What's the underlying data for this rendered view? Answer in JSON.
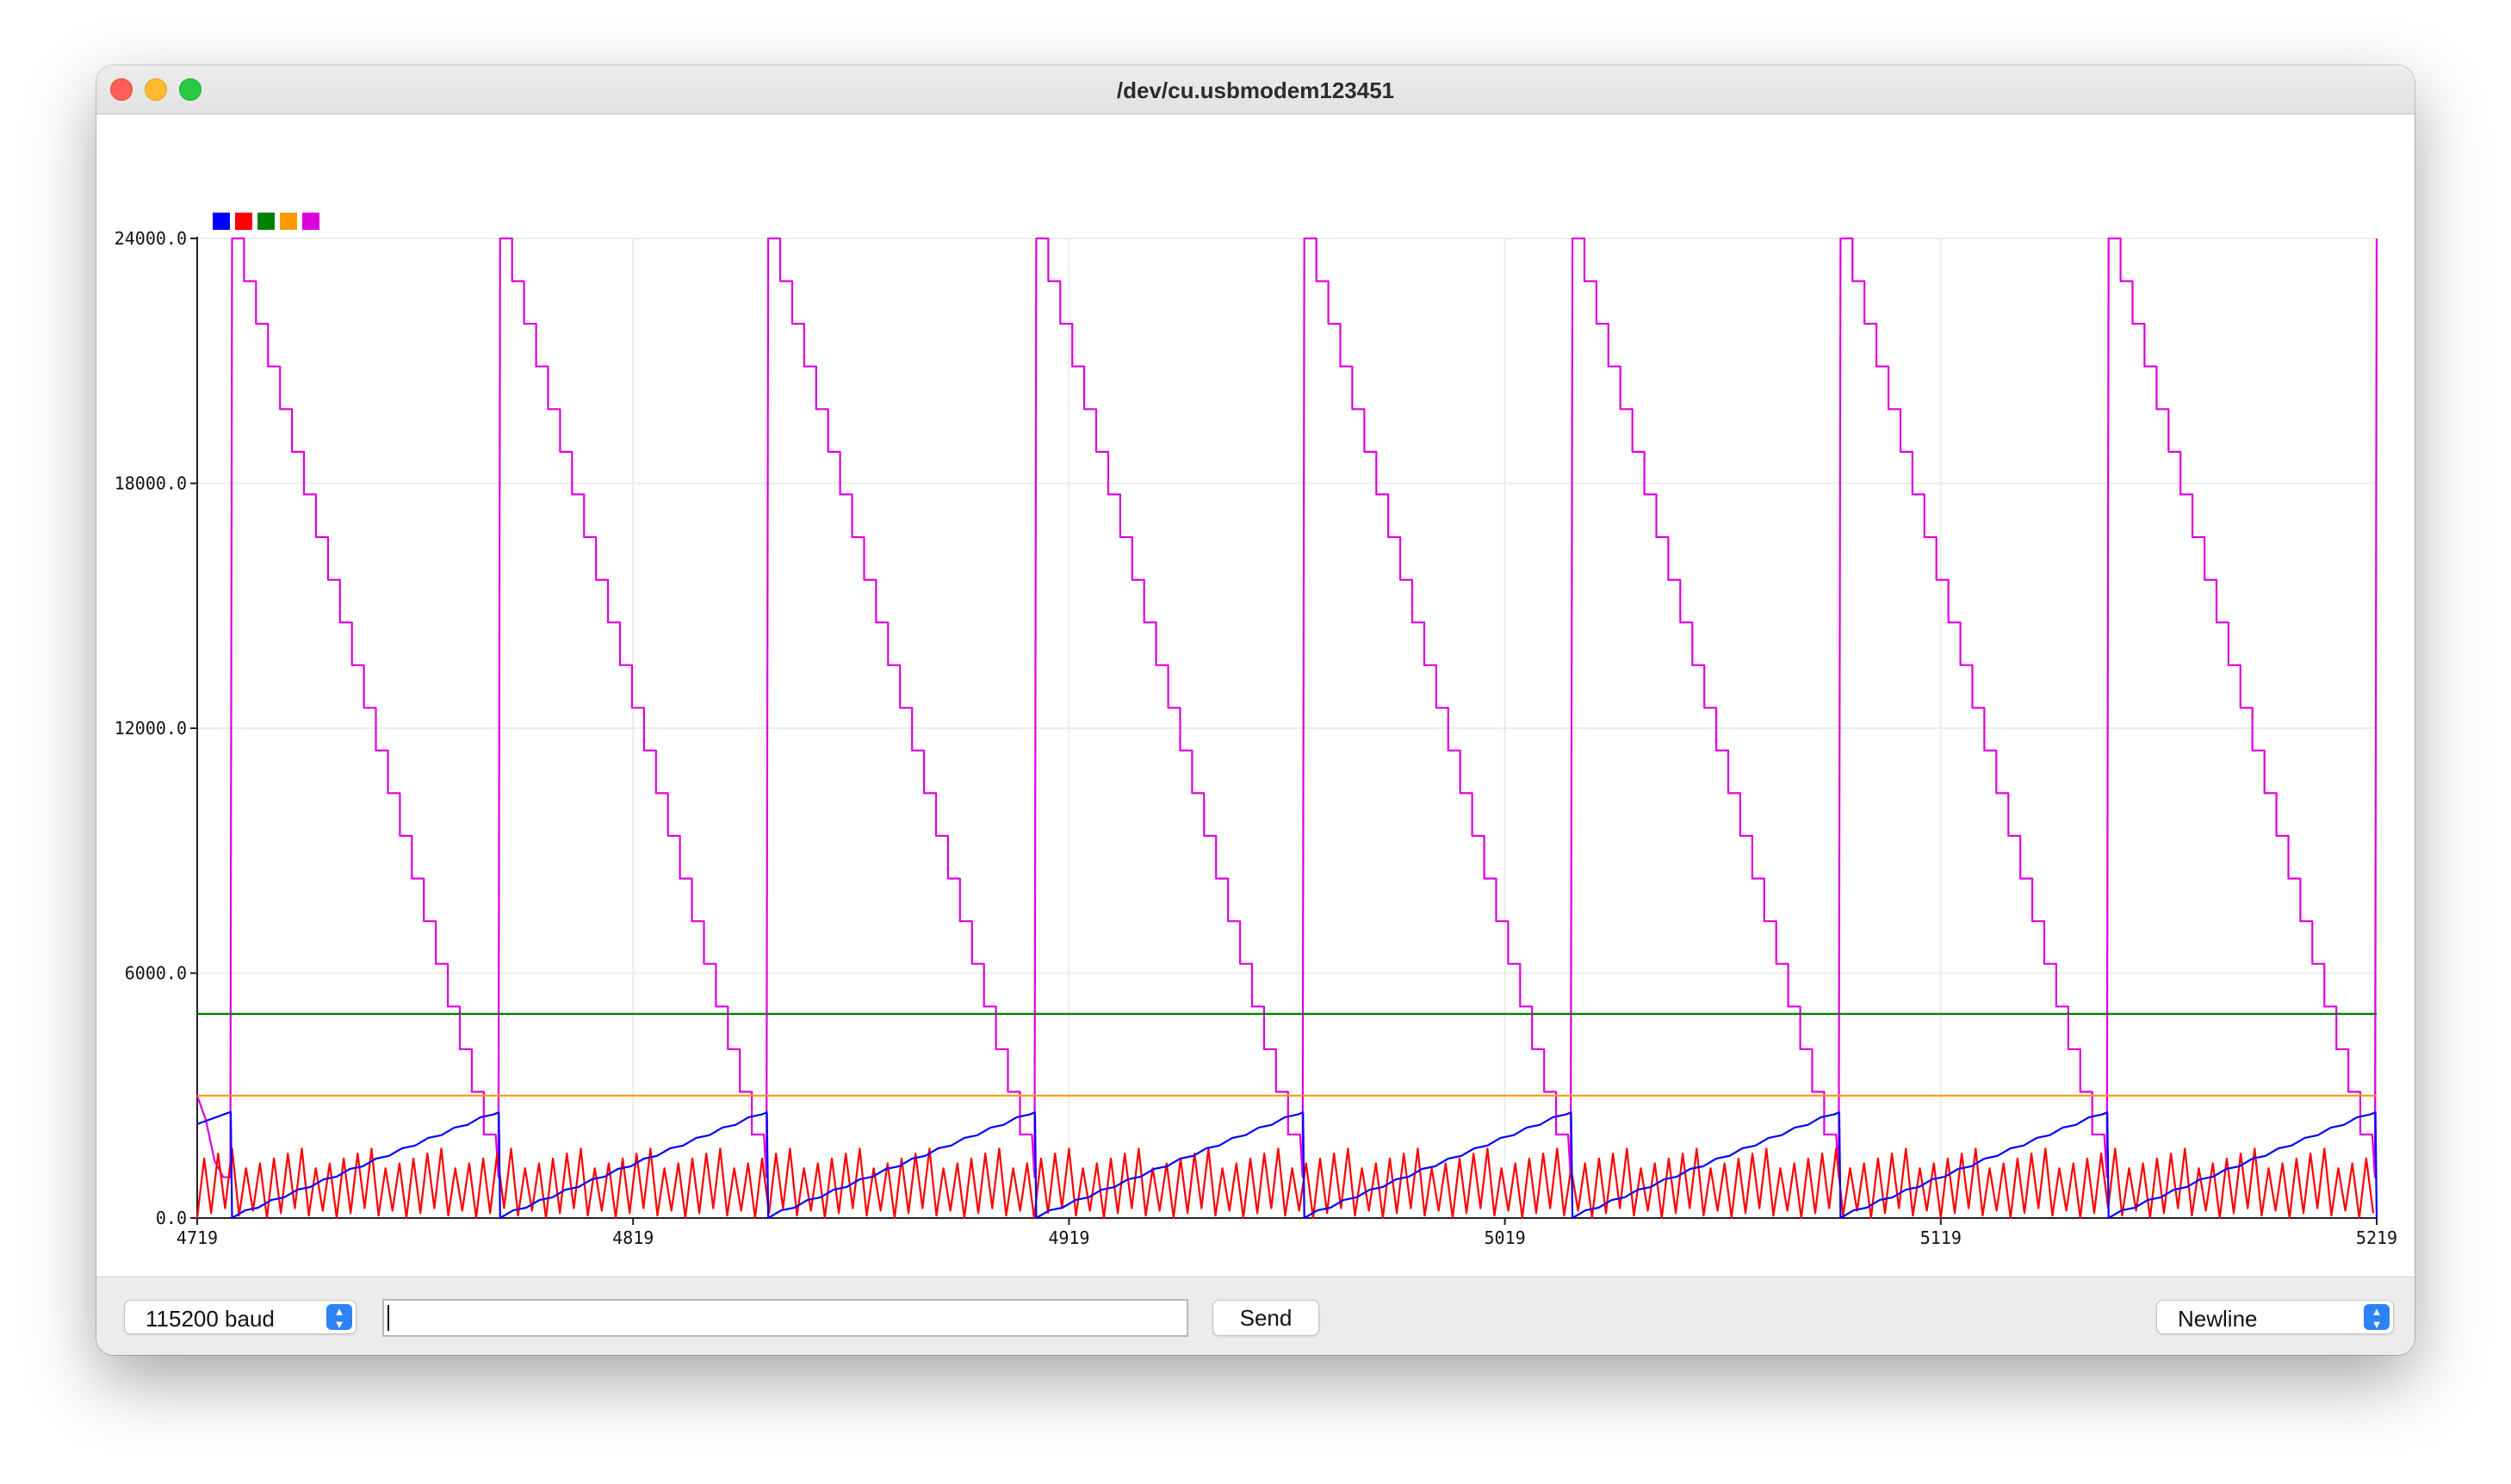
{
  "window": {
    "title": "/dev/cu.usbmodem123451"
  },
  "bottom_bar": {
    "baud_value": "115200 baud",
    "send_label": "Send",
    "input_value": "",
    "line_ending_value": "Newline"
  },
  "chart_data": {
    "type": "line",
    "title": "",
    "xlabel": "",
    "ylabel": "",
    "xlim": [
      4719,
      5219
    ],
    "ylim": [
      0,
      24000
    ],
    "x_ticks": [
      4719,
      4819,
      4919,
      5019,
      5119,
      5219
    ],
    "y_ticks": [
      "0.0",
      "6000.0",
      "12000.0",
      "18000.0",
      "24000.0"
    ],
    "grid": true,
    "legend": "top-left, color swatches only",
    "period": 61.5,
    "series": [
      {
        "color": "#0000ff",
        "shape": "sawtooth ramp",
        "min": 0,
        "max": 2600
      },
      {
        "color": "#ff0000",
        "shape": "zigzag oscillation",
        "min": 0,
        "max": 1700
      },
      {
        "color": "#008000",
        "shape": "constant",
        "value": 5000
      },
      {
        "color": "#ff9900",
        "shape": "constant",
        "value": 3000
      },
      {
        "color": "#dd00dd",
        "shape": "stepped descending sawtooth",
        "min": 1000,
        "max": 24000
      }
    ]
  }
}
